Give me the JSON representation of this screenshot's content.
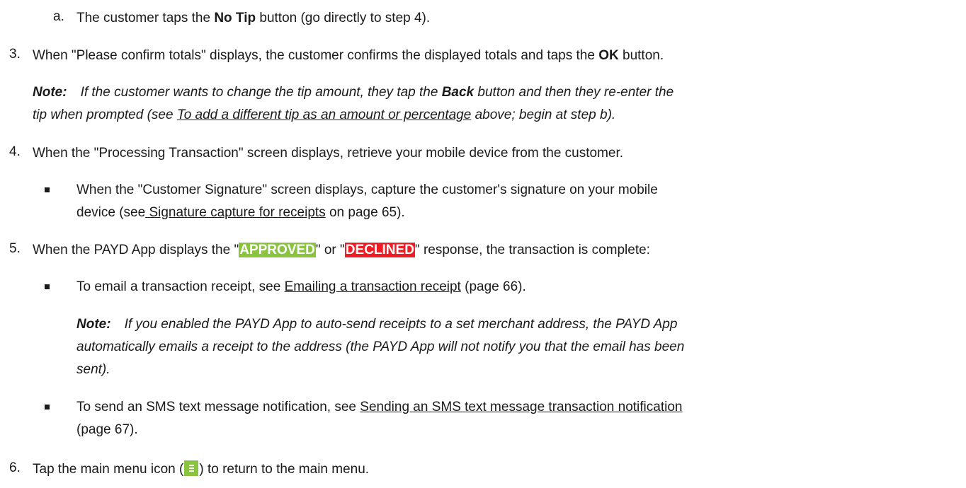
{
  "step_a": {
    "marker": "a.",
    "t1": "The customer taps the ",
    "b1": "No Tip",
    "t2": " button (go directly to step 4)."
  },
  "step3": {
    "marker": "3.",
    "t1": "When \"Please confirm totals\" displays, the customer confirms the displayed totals and taps the ",
    "b1": "OK",
    "t2": " button."
  },
  "note1": {
    "label": "Note:",
    "l1a": "If the customer wants to change the tip amount, they tap the ",
    "l1b": "Back",
    "l1c": " button and then they re-enter the",
    "l2a": "tip when prompted (see ",
    "l2link": "To add a different tip as an amount or percentage",
    "l2b": " above; begin at step b)."
  },
  "step4": {
    "marker": "4.",
    "text": "When the \"Processing Transaction\" screen displays, retrieve your mobile device from the customer.",
    "bullet": {
      "l1": "When the \"Customer Signature\" screen displays, capture the customer's signature on your mobile",
      "l2a": "device (see",
      "l2link": " Signature capture for receipts",
      "l2b": " on page 65)."
    }
  },
  "step5": {
    "marker": "5.",
    "t1": "When the PAYD App displays the \"",
    "approved": "APPROVED",
    "t2": "\" or \"",
    "declined": "DECLINED",
    "t3": "\" response, the transaction is complete:",
    "bullet1": {
      "t1": "To email a transaction receipt, see ",
      "link": "Emailing a transaction receipt",
      "t2": " (page 66)."
    },
    "note2": {
      "label": "Note:",
      "l1": "If you enabled the PAYD App to auto-send receipts to a set merchant address, the PAYD App",
      "l2": "automatically emails a receipt to the address (the PAYD App will not notify you that the email has been",
      "l3": "sent)."
    },
    "bullet2": {
      "t1": "To send an SMS text message notification, see ",
      "link": "Sending an SMS text message transaction notification",
      "l2": "(page 67)."
    }
  },
  "step6": {
    "marker": "6.",
    "t1": "Tap the main menu icon (",
    "icon": "main-menu-icon",
    "t2": ") to return to the main menu."
  },
  "colors": {
    "approved_bg": "#8ac43f",
    "declined_bg": "#ee1c25",
    "menu_icon_bg": "#8ac43f"
  }
}
